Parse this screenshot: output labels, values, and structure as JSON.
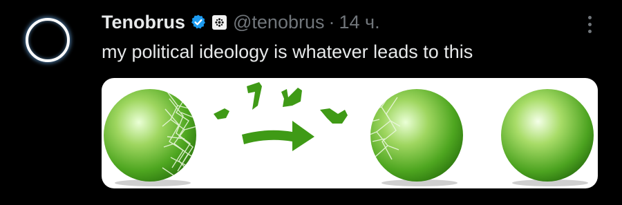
{
  "tweet": {
    "author_name": "Tenobrus",
    "handle": "@tenobrus",
    "separator": "·",
    "timestamp": "14 ч.",
    "text": "my political ideology is whatever leads to this",
    "verified": true,
    "accent_color": "#1d9bf0"
  },
  "icons": {
    "verified": "verified-badge-icon",
    "affiliate": "affiliate-badge-icon",
    "more": "more-options-icon"
  },
  "image": {
    "description_icons": [
      "cracked-sphere",
      "fragments-and-arrow",
      "cracked-sphere",
      "smooth-sphere"
    ]
  }
}
